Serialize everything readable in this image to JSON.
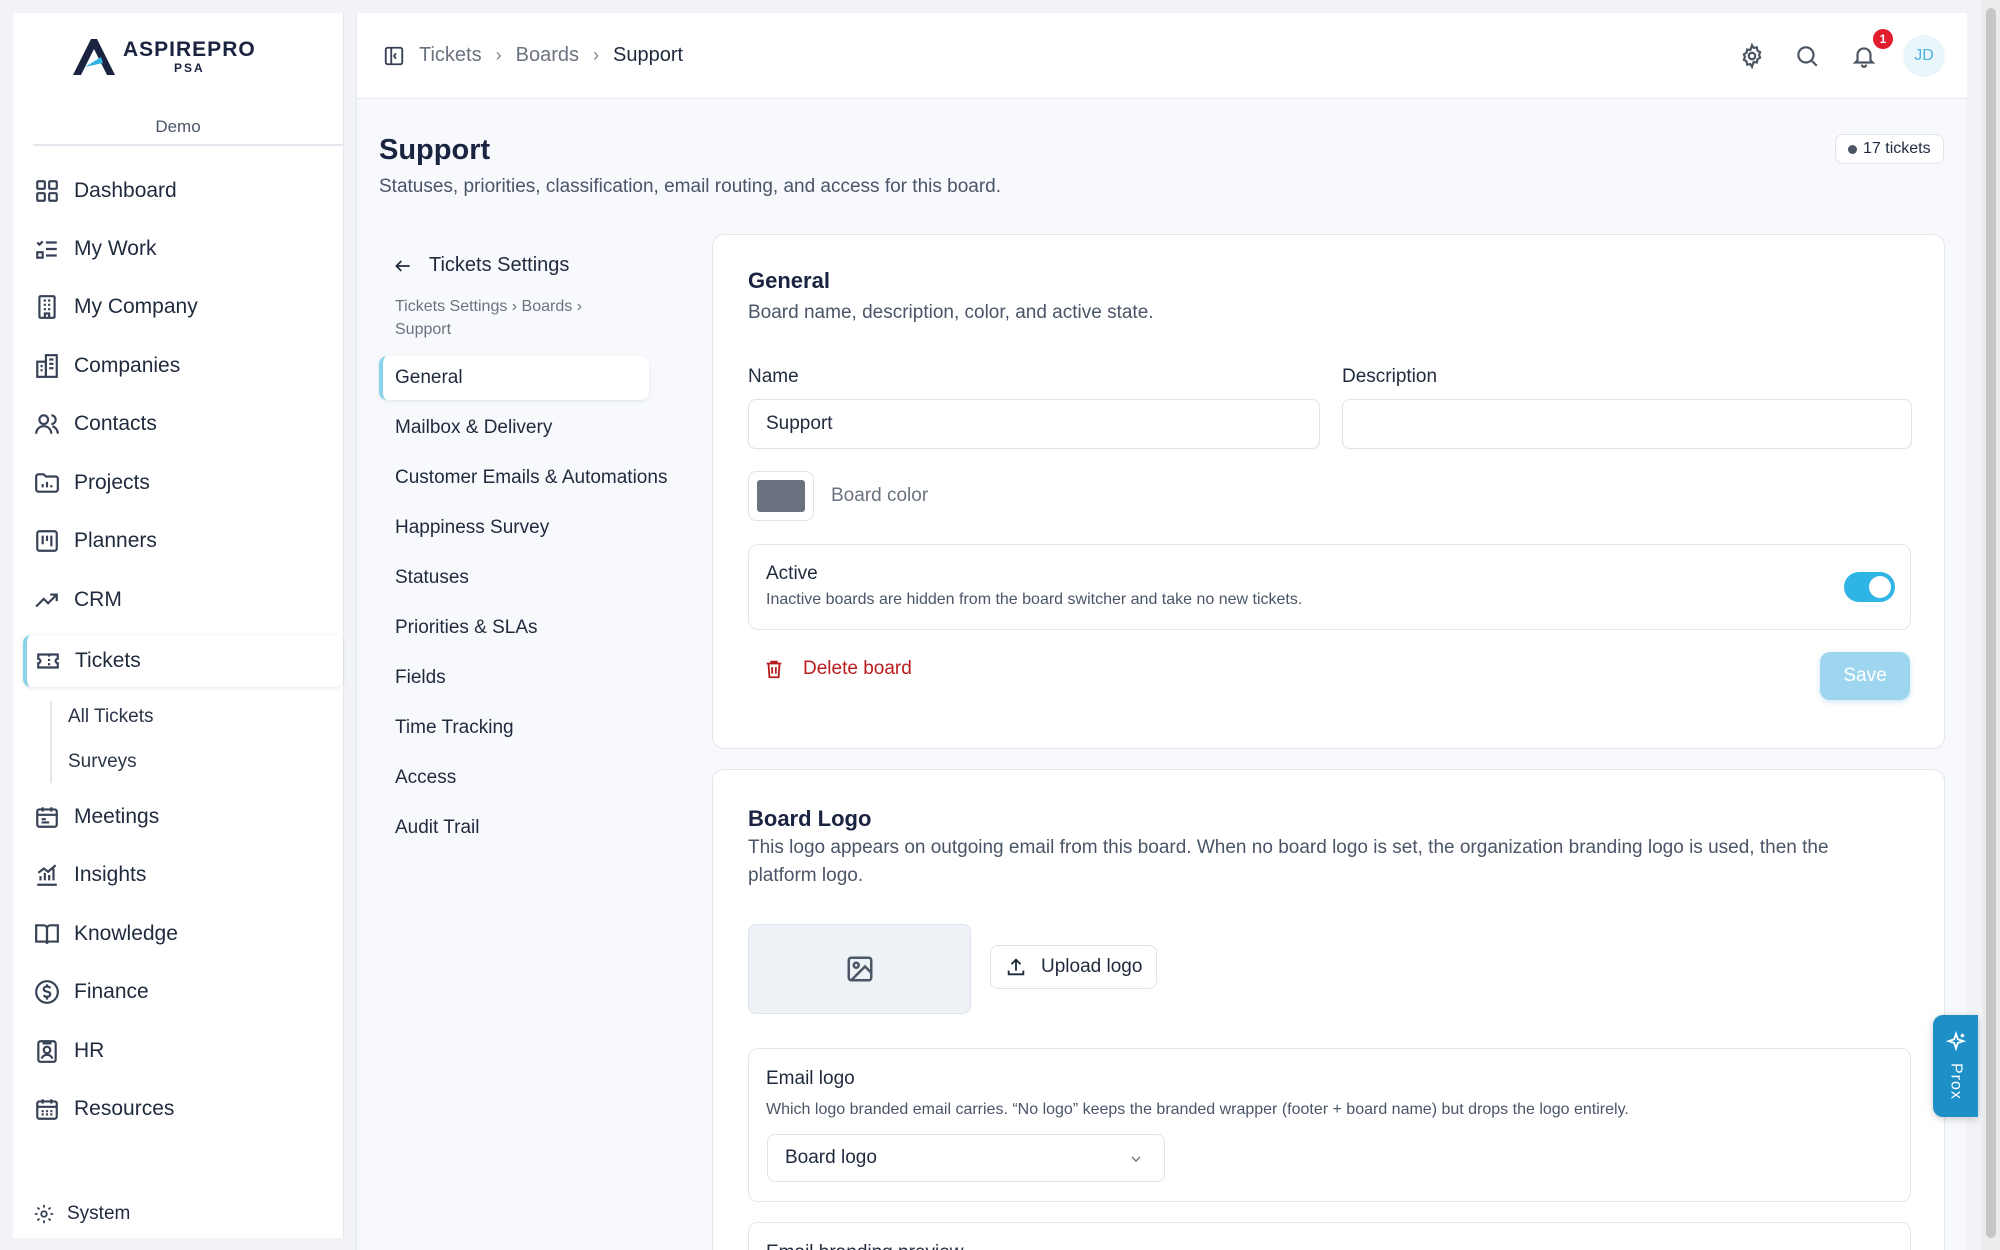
{
  "brand": {
    "name": "ASPIREPRO",
    "sub": "PSA",
    "org": "Demo"
  },
  "sidebar": {
    "items": [
      {
        "label": "Dashboard",
        "icon": "grid-icon"
      },
      {
        "label": "My Work",
        "icon": "list-check-icon"
      },
      {
        "label": "My Company",
        "icon": "building-icon"
      },
      {
        "label": "Companies",
        "icon": "buildings-icon"
      },
      {
        "label": "Contacts",
        "icon": "users-icon"
      },
      {
        "label": "Projects",
        "icon": "folder-chart-icon"
      },
      {
        "label": "Planners",
        "icon": "kanban-icon"
      },
      {
        "label": "CRM",
        "icon": "trend-up-icon"
      },
      {
        "label": "Tickets",
        "icon": "ticket-icon"
      },
      {
        "label": "Meetings",
        "icon": "calendar-icon"
      },
      {
        "label": "Insights",
        "icon": "bar-chart-icon"
      },
      {
        "label": "Knowledge",
        "icon": "book-icon"
      },
      {
        "label": "Finance",
        "icon": "dollar-circle-icon"
      },
      {
        "label": "HR",
        "icon": "id-badge-icon"
      },
      {
        "label": "Resources",
        "icon": "calendar-grid-icon"
      }
    ],
    "sub_items": [
      "All Tickets",
      "Surveys"
    ],
    "system": "System"
  },
  "topbar": {
    "breadcrumbs": [
      "Tickets",
      "Boards",
      "Support"
    ],
    "notification_count": "1",
    "avatar_initials": "JD"
  },
  "page": {
    "title": "Support",
    "subtitle": "Statuses, priorities, classification, email routing, and access for this board.",
    "ticket_count": "17 tickets"
  },
  "settings_nav": {
    "back_label": "Tickets Settings",
    "crumb": "Tickets Settings › Boards › Support",
    "items": [
      "General",
      "Mailbox & Delivery",
      "Customer Emails & Automations",
      "Happiness Survey",
      "Statuses",
      "Priorities & SLAs",
      "Fields",
      "Time Tracking",
      "Access",
      "Audit Trail"
    ]
  },
  "general": {
    "title": "General",
    "subtitle": "Board name, description, color, and active state.",
    "name_label": "Name",
    "name_value": "Support",
    "description_label": "Description",
    "description_value": "",
    "color_label": "Board color",
    "color_value": "#6b7280",
    "active_title": "Active",
    "active_desc": "Inactive boards are hidden from the board switcher and take no new tickets.",
    "active_on": true,
    "delete_label": "Delete board",
    "save_label": "Save"
  },
  "board_logo": {
    "title": "Board Logo",
    "subtitle": "This logo appears on outgoing email from this board. When no board logo is set, the organization branding logo is used, then the platform logo.",
    "upload_label": "Upload logo",
    "email_logo_title": "Email logo",
    "email_logo_desc": "Which logo branded email carries. “No logo” keeps the branded wrapper (footer + board name) but drops the logo entirely.",
    "email_logo_selected": "Board logo",
    "preview_title": "Email branding preview"
  },
  "assistant": {
    "label": "Prox"
  },
  "colors": {
    "accent": "#2fb4e6",
    "toggle": "#2fb4e6",
    "save_disabled": "#9fd6ef",
    "danger": "#b91c1c",
    "prox_bg": "#1f8fc8"
  }
}
